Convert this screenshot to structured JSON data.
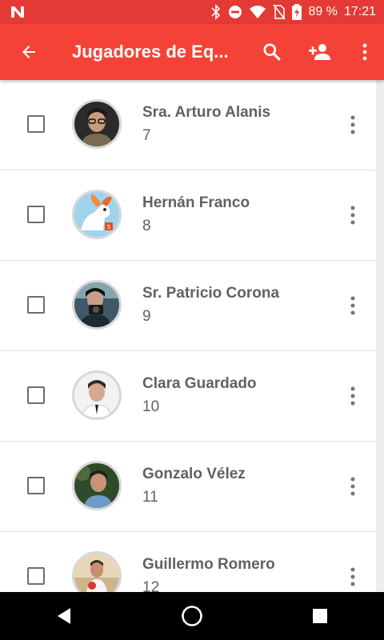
{
  "status_bar": {
    "battery": "89 %",
    "time": "17:21",
    "icons": [
      "n-logo-icon",
      "bluetooth-icon",
      "do-not-disturb-icon",
      "wifi-icon",
      "no-sim-icon",
      "battery-charging-icon"
    ]
  },
  "app_bar": {
    "title": "Jugadores de Eq...",
    "icons": [
      "arrow-back-icon",
      "search-icon",
      "person-add-icon",
      "more-vert-icon"
    ]
  },
  "players": [
    {
      "name": "Sra. Arturo Alanis",
      "number": "7"
    },
    {
      "name": "Hernán Franco",
      "number": "8"
    },
    {
      "name": "Sr. Patricio Corona",
      "number": "9"
    },
    {
      "name": "Clara Guardado",
      "number": "10"
    },
    {
      "name": "Gonzalo Vélez",
      "number": "11"
    },
    {
      "name": "Guillermo Romero",
      "number": "12"
    }
  ],
  "nav_bar": {
    "icons": [
      "back-triangle-icon",
      "home-circle-icon",
      "recents-square-icon"
    ]
  },
  "colors": {
    "status_bar": "#e53935",
    "app_bar": "#f44336",
    "text": "#616161",
    "divider": "#e0e0e0"
  }
}
